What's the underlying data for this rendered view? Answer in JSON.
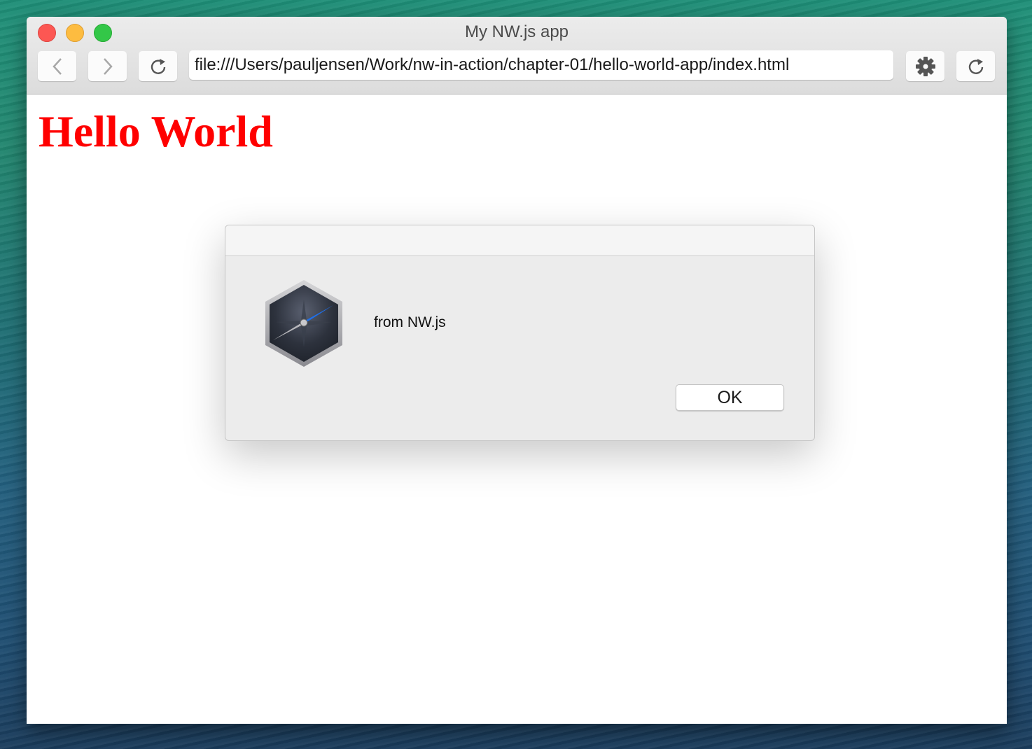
{
  "window": {
    "title": "My NW.js app",
    "traffic_lights": {
      "close": "#fc5753",
      "minimize": "#fdbc40",
      "maximize": "#33c748"
    }
  },
  "toolbar": {
    "back_icon": "chevron-left-icon",
    "forward_icon": "chevron-right-icon",
    "reload_icon": "reload-icon",
    "url": "file:///Users/pauljensen/Work/nw-in-action/chapter-01/hello-world-app/index.html",
    "devtools_icon": "gear-icon",
    "reload_app_icon": "reload-icon"
  },
  "page": {
    "heading": "Hello World",
    "heading_color": "#ff0000"
  },
  "dialog": {
    "icon": "compass-icon",
    "message": "from NW.js",
    "ok_label": "OK"
  }
}
